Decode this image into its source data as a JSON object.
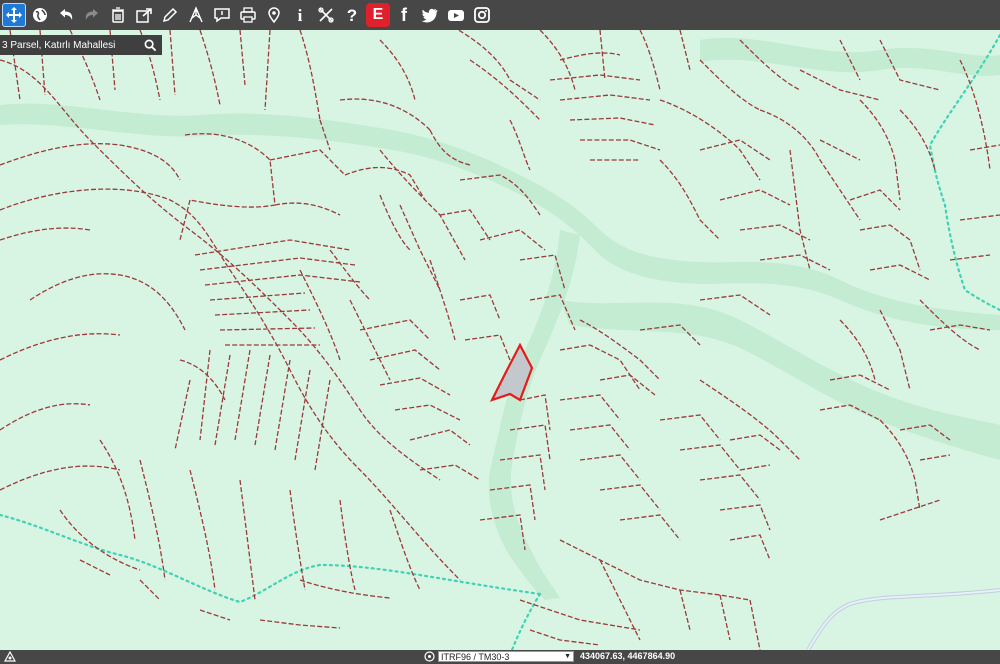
{
  "map": {
    "background_color": "#d8f5e3",
    "valley_color": "#c4ecd3",
    "parcel_border_color": "#9b3a3a",
    "boundary_dotted_color": "#3fd2b4",
    "selected_parcel_fill": "#c3c8cc",
    "selected_parcel_stroke": "#e41b1b",
    "road_color": "#bfcfe0"
  },
  "toolbar": {
    "buttons": [
      {
        "name": "pan-icon",
        "state": "active"
      },
      {
        "name": "globe-icon",
        "state": "normal"
      },
      {
        "name": "undo-icon",
        "state": "normal"
      },
      {
        "name": "redo-icon",
        "state": "disabled"
      },
      {
        "name": "trash-icon",
        "state": "normal"
      },
      {
        "name": "share-icon",
        "state": "normal"
      },
      {
        "name": "pencil-icon",
        "state": "normal"
      },
      {
        "name": "measure-icon",
        "state": "normal"
      },
      {
        "name": "comment-icon",
        "state": "normal"
      },
      {
        "name": "print-icon",
        "state": "normal"
      },
      {
        "name": "location-pin-icon",
        "state": "normal"
      },
      {
        "name": "info-icon",
        "state": "normal"
      },
      {
        "name": "tools-icon",
        "state": "normal"
      },
      {
        "name": "help-icon",
        "state": "normal"
      },
      {
        "name": "e-devlet-icon",
        "state": "normal"
      },
      {
        "name": "facebook-icon",
        "state": "normal"
      },
      {
        "name": "twitter-icon",
        "state": "normal"
      },
      {
        "name": "youtube-icon",
        "state": "normal"
      },
      {
        "name": "instagram-icon",
        "state": "normal"
      }
    ],
    "glyphs": {
      "info": "i",
      "help": "?",
      "e_devlet": "E",
      "facebook": "f"
    }
  },
  "search": {
    "value": "3 Parsel, Katırlı Mahallesi"
  },
  "status": {
    "projection": "ITRF96 / TM30-3",
    "coordinates": "434067.63, 4467864.90"
  }
}
